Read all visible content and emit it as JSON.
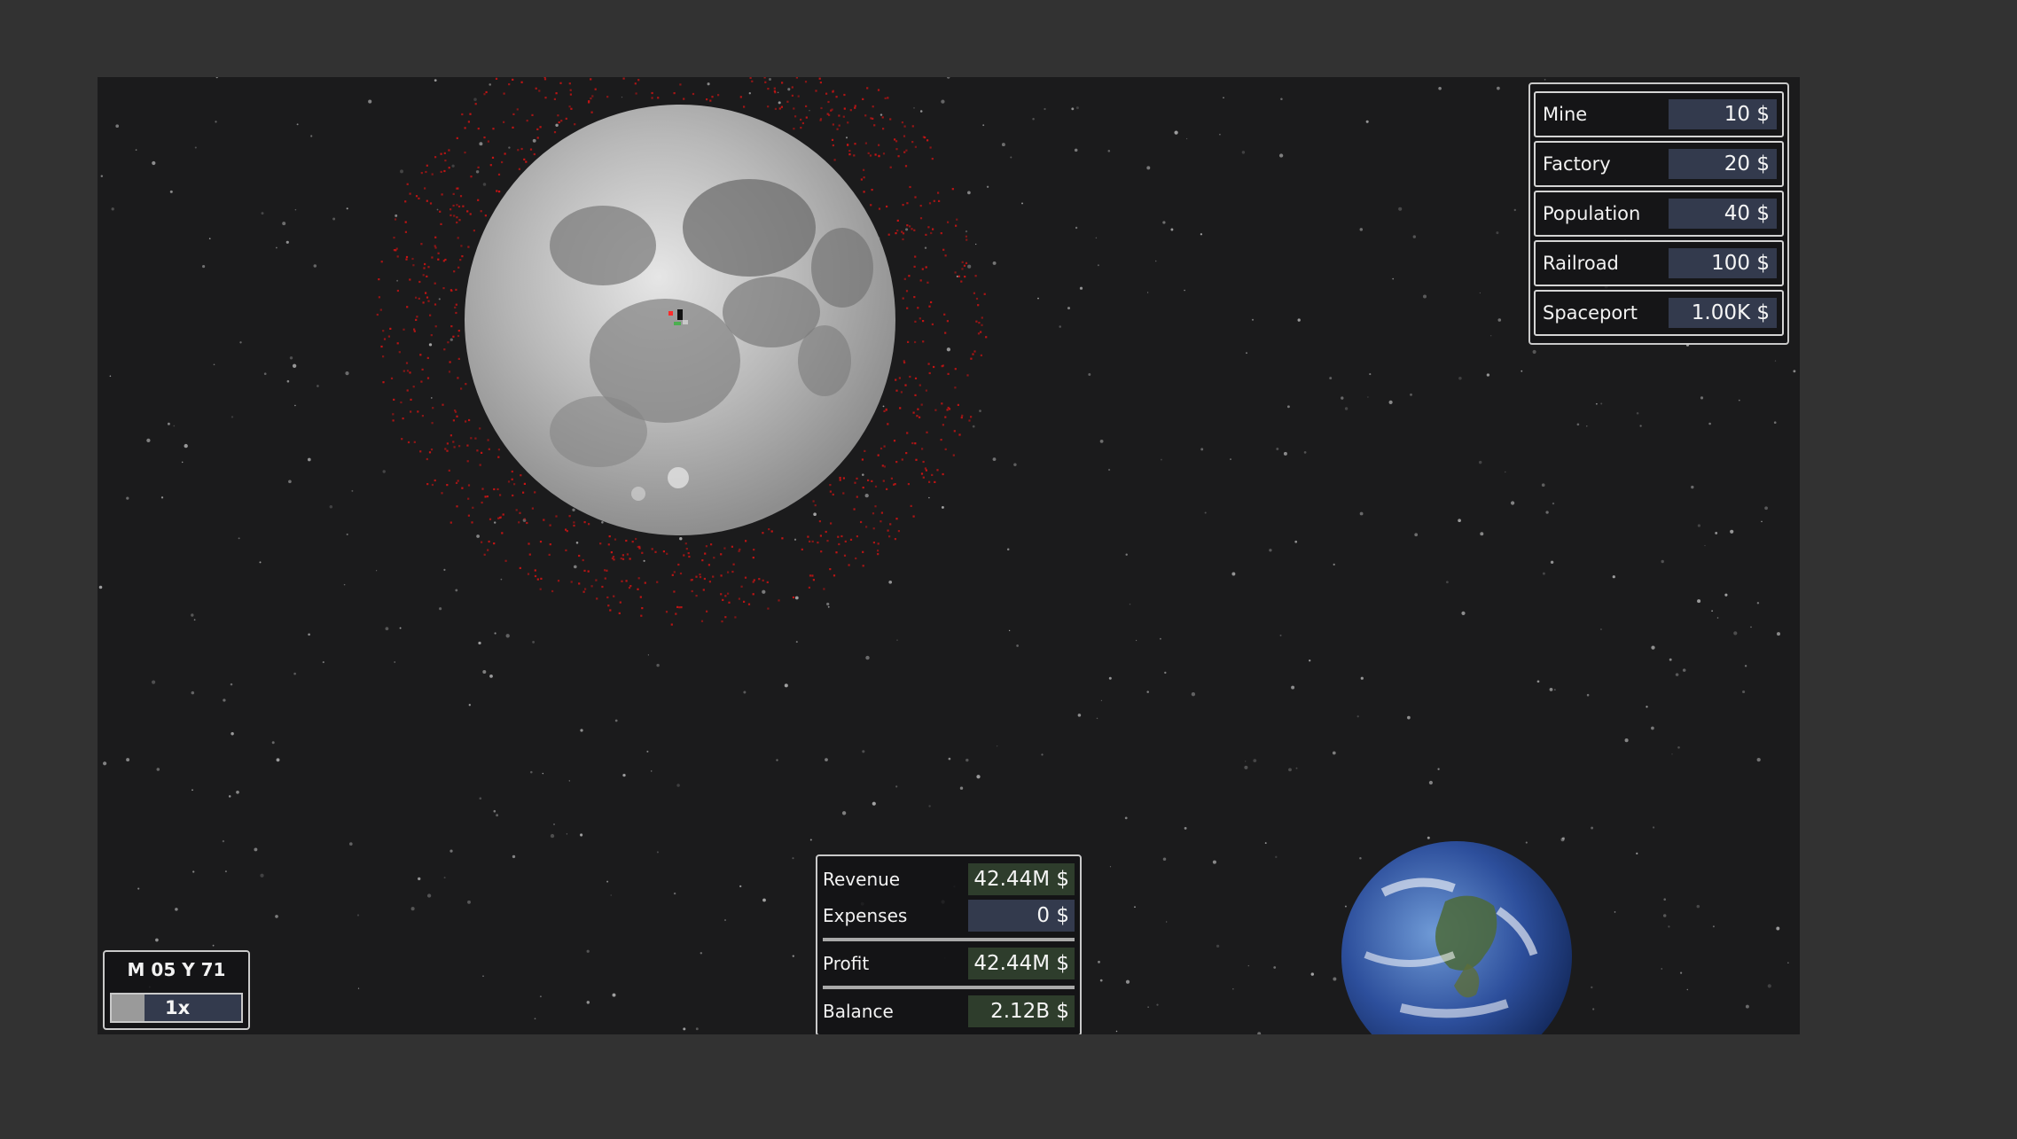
{
  "build_menu": {
    "items": [
      {
        "label": "Mine",
        "price": "10 $"
      },
      {
        "label": "Factory",
        "price": "20 $"
      },
      {
        "label": "Population",
        "price": "40 $"
      },
      {
        "label": "Railroad",
        "price": "100 $"
      },
      {
        "label": "Spaceport",
        "price": "1.00K $"
      }
    ]
  },
  "finance": {
    "revenue_label": "Revenue",
    "revenue": "42.44M $",
    "expenses_label": "Expenses",
    "expenses": "0 $",
    "profit_label": "Profit",
    "profit": "42.44M $",
    "balance_label": "Balance",
    "balance": "2.12B $"
  },
  "time": {
    "date": "M 05 Y 71",
    "speed_label": "1x",
    "speed_level": 0.25
  },
  "colors": {
    "space": "#1b1b1c",
    "panel_border": "#c9c9c9",
    "value_positive": "#2e3d2c",
    "value_neutral": "#333a4d",
    "debris": "#c81414"
  },
  "icons": {
    "moon": "moon-planet-icon",
    "earth": "earth-planet-icon",
    "base": "lunar-base-icon"
  }
}
